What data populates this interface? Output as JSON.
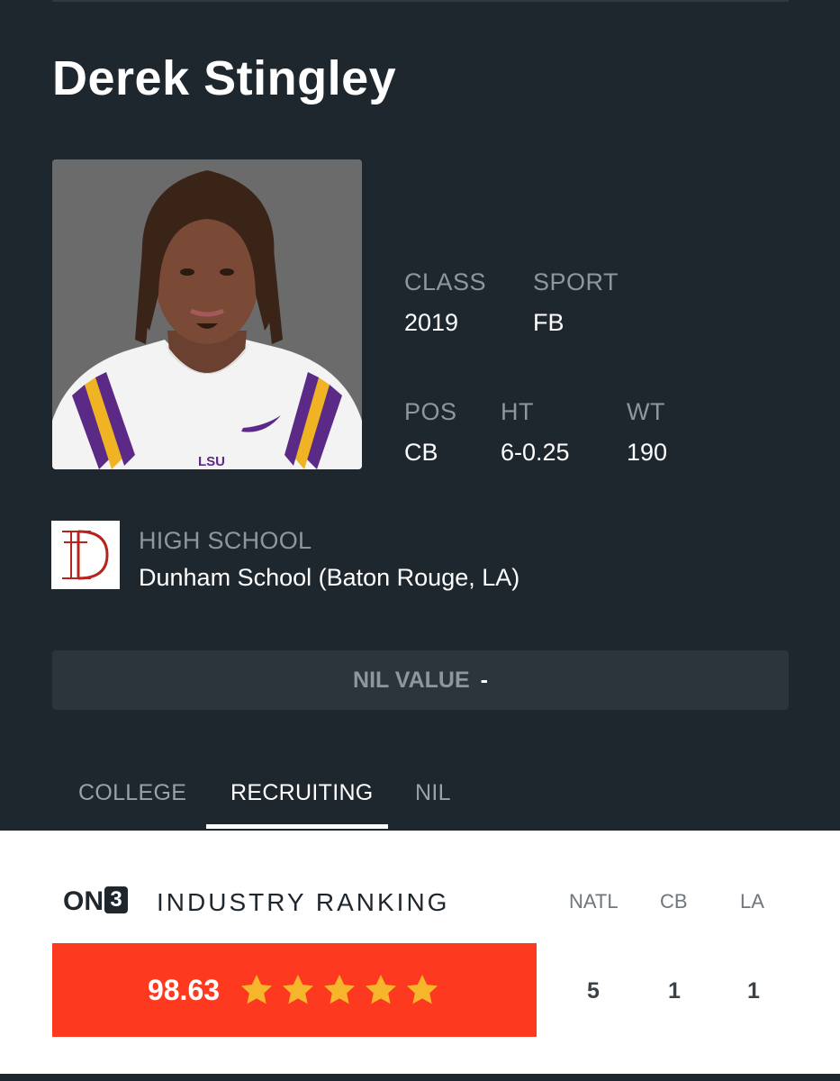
{
  "player": {
    "name": "Derek Stingley",
    "class_label": "CLASS",
    "class_value": "2019",
    "sport_label": "SPORT",
    "sport_value": "FB",
    "pos_label": "POS",
    "pos_value": "CB",
    "ht_label": "HT",
    "ht_value": "6-0.25",
    "wt_label": "WT",
    "wt_value": "190",
    "jersey_text": "LSU"
  },
  "school": {
    "label": "HIGH SCHOOL",
    "value": "Dunham School (Baton Rouge, LA)"
  },
  "nil": {
    "label": "NIL VALUE",
    "value": "-"
  },
  "tabs": [
    {
      "label": "COLLEGE"
    },
    {
      "label": "RECRUITING"
    },
    {
      "label": "NIL"
    }
  ],
  "ranking": {
    "brand": "ON",
    "brand_number": "3",
    "title": "INDUSTRY RANKING",
    "score": "98.63",
    "stars": 5,
    "headers": [
      "NATL",
      "CB",
      "LA"
    ],
    "values": [
      "5",
      "1",
      "1"
    ]
  },
  "colors": {
    "background": "#1e262e",
    "score_box": "#fd3a20",
    "star": "#f6b62b",
    "school_logo": "#b7231f"
  }
}
